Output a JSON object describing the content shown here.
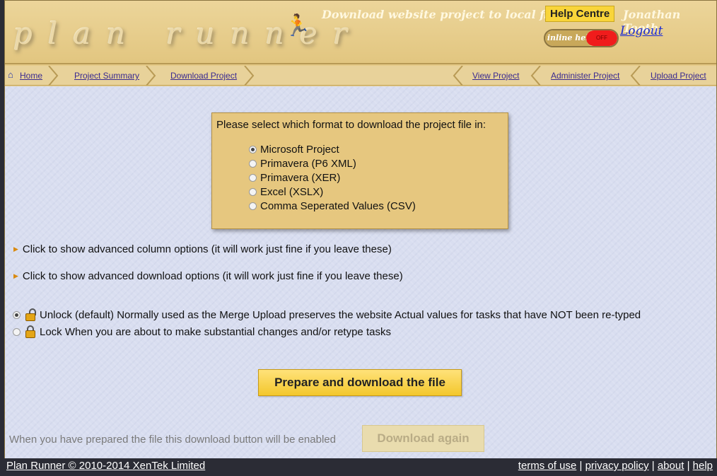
{
  "header": {
    "logo_text": "plan runner",
    "title": "Download website project to local file",
    "help_centre": "Help Centre",
    "user": "Jonathan Tooth",
    "toggle_label": "inline help",
    "toggle_off": "OFF",
    "logout": "Logout"
  },
  "nav": {
    "left": [
      "Home",
      "Project Summary",
      "Download Project"
    ],
    "right": [
      "View Project",
      "Administer Project",
      "Upload Project"
    ]
  },
  "format": {
    "prompt": "Please select which format to download the project file in:",
    "options": [
      "Microsoft Project",
      "Primavera (P6 XML)",
      "Primavera (XER)",
      "Excel (XSLX)",
      "Comma Seperated Values (CSV)"
    ],
    "selected": "Microsoft Project"
  },
  "advanced": {
    "columns": "Click to show advanced column options (it will work just fine if you leave these)",
    "download": "Click to show advanced download options (it will work just fine if you leave these)"
  },
  "lock_options": {
    "unlock": "Unlock (default)  Normally used as the Merge Upload preserves the website Actual values for tasks that have NOT been re-typed",
    "lock": "Lock  When you are about to make substantial changes and/or retype tasks",
    "selected": "unlock"
  },
  "actions": {
    "prepare": "Prepare and download the file",
    "again_note": "When you have prepared the file this download button will be enabled",
    "again": "Download again"
  },
  "footer": {
    "copyright": "Plan Runner © 2010-2014 XenTek Limited",
    "links": [
      "terms of use",
      "privacy policy",
      "about",
      "help"
    ],
    "separator": "|"
  },
  "colors": {
    "header_bg": "#e4c987",
    "content_bg": "#d9def0",
    "accent_button": "#f3c72c",
    "footer_bg": "#2b2c35"
  }
}
